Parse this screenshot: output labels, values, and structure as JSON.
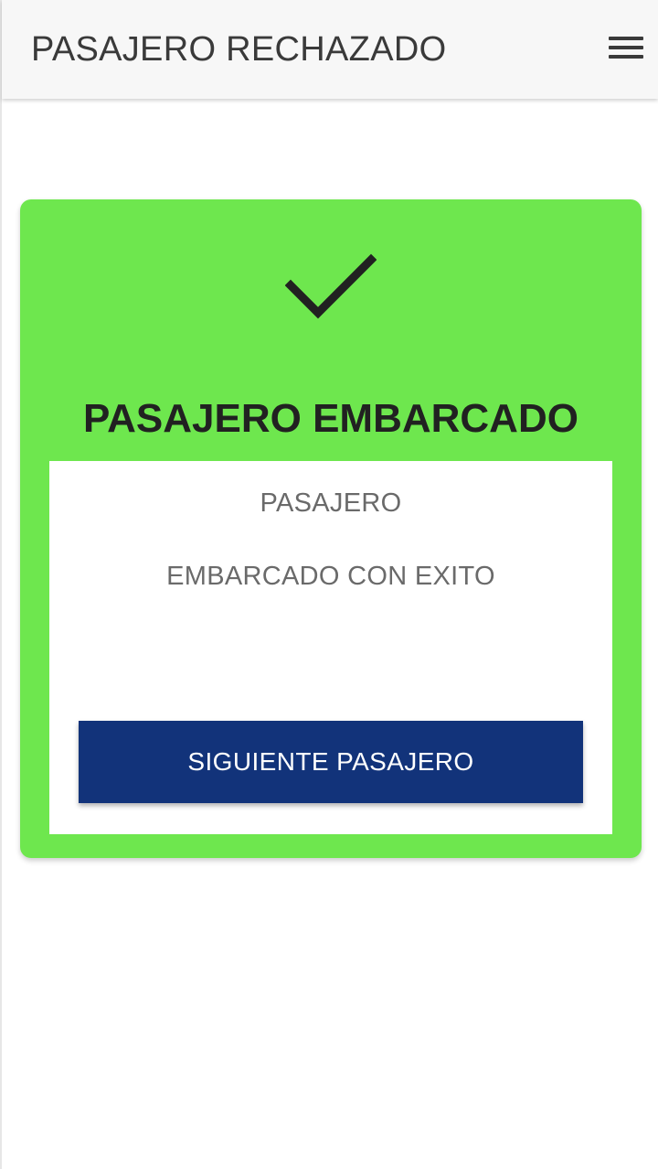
{
  "header": {
    "title": "PASAJERO RECHAZADO",
    "menu_icon": "hamburger-menu-icon"
  },
  "status_card": {
    "icon": "checkmark-icon",
    "heading": "PASAJERO EMBARCADO",
    "line_1": "PASAJERO",
    "line_2": "EMBARCADO CON EXITO",
    "button_label": "SIGUIENTE PASAJERO"
  },
  "colors": {
    "card_background": "#6ee74e",
    "button_background": "#12337a",
    "icon_color": "#212121"
  }
}
